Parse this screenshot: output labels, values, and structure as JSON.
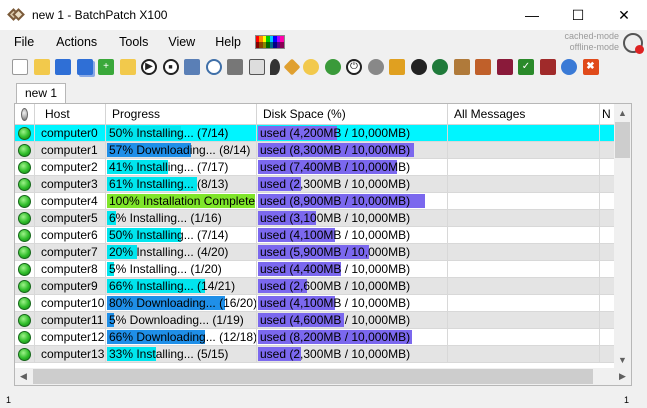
{
  "window": {
    "title": "new 1 - BatchPatch X100",
    "minimize_glyph": "—",
    "maximize_glyph": "☐",
    "close_glyph": "✕"
  },
  "menu": {
    "items": [
      "File",
      "Actions",
      "Tools",
      "View",
      "Help"
    ]
  },
  "modes": {
    "cached": "cached-mode",
    "offline": "offline-mode"
  },
  "toolbar": {
    "icons": [
      "new-file-icon",
      "open-folder-icon",
      "save-icon",
      "save-all-icon",
      "add-host-icon",
      "group-icon",
      "play-icon",
      "stop-icon",
      "network-icon",
      "schedule-icon",
      "deploy-icon",
      "script-icon",
      "location-icon",
      "tag-icon",
      "search-icon",
      "refresh-icon",
      "power-icon",
      "settings-icon",
      "unlock-icon",
      "wheel-icon",
      "wheel-green-icon",
      "package-icon",
      "commands-icon",
      "book-icon",
      "check-icon",
      "monitor-icon",
      "globe-icon",
      "remove-icon"
    ]
  },
  "tabs": [
    {
      "label": "new 1"
    }
  ],
  "grid": {
    "headers": {
      "host": "Host",
      "progress": "Progress",
      "disk": "Disk Space (%)",
      "messages": "All Messages",
      "next": "N"
    },
    "rows": [
      {
        "host": "computer0",
        "progress": "50% Installing... (7/14)",
        "progress_pct": 50,
        "progress_kind": "install",
        "disk": "used (4,200MB / 10,000MB)",
        "disk_pct": 42,
        "selected": true
      },
      {
        "host": "computer1",
        "progress": "57% Downloading... (8/14)",
        "progress_pct": 57,
        "progress_kind": "download",
        "disk": "used (8,300MB / 10,000MB)",
        "disk_pct": 83
      },
      {
        "host": "computer2",
        "progress": "41% Installing... (7/17)",
        "progress_pct": 41,
        "progress_kind": "install",
        "disk": "used (7,400MB / 10,000MB)",
        "disk_pct": 74
      },
      {
        "host": "computer3",
        "progress": "61% Installing... (8/13)",
        "progress_pct": 61,
        "progress_kind": "install",
        "disk": "used (2,300MB / 10,000MB)",
        "disk_pct": 23
      },
      {
        "host": "computer4",
        "progress": "100% Installation Complete",
        "progress_pct": 100,
        "progress_kind": "complete",
        "disk": "used (8,900MB / 10,000MB)",
        "disk_pct": 89
      },
      {
        "host": "computer5",
        "progress": "6% Installing... (1/16)",
        "progress_pct": 6,
        "progress_kind": "install",
        "disk": "used (3,100MB / 10,000MB)",
        "disk_pct": 31
      },
      {
        "host": "computer6",
        "progress": "50% Installing... (7/14)",
        "progress_pct": 50,
        "progress_kind": "install",
        "disk": "used (4,100MB / 10,000MB)",
        "disk_pct": 41
      },
      {
        "host": "computer7",
        "progress": "20% Installing... (4/20)",
        "progress_pct": 20,
        "progress_kind": "install",
        "disk": "used (5,900MB / 10,000MB)",
        "disk_pct": 59
      },
      {
        "host": "computer8",
        "progress": "5% Installing... (1/20)",
        "progress_pct": 5,
        "progress_kind": "install",
        "disk": "used (4,400MB / 10,000MB)",
        "disk_pct": 44
      },
      {
        "host": "computer9",
        "progress": "66% Installing... (14/21)",
        "progress_pct": 66,
        "progress_kind": "install",
        "disk": "used (2,600MB / 10,000MB)",
        "disk_pct": 26
      },
      {
        "host": "computer10",
        "progress": "80% Downloading... (16/20)",
        "progress_pct": 80,
        "progress_kind": "download",
        "disk": "used (4,100MB / 10,000MB)",
        "disk_pct": 41
      },
      {
        "host": "computer11",
        "progress": "5% Downloading... (1/19)",
        "progress_pct": 5,
        "progress_kind": "download",
        "disk": "used (4,600MB / 10,000MB)",
        "disk_pct": 46
      },
      {
        "host": "computer12",
        "progress": "66% Downloading... (12/18)",
        "progress_pct": 66,
        "progress_kind": "download",
        "disk": "used (8,200MB / 10,000MB)",
        "disk_pct": 82
      },
      {
        "host": "computer13",
        "progress": "33% Installing... (5/15)",
        "progress_pct": 33,
        "progress_kind": "install",
        "disk": "used (2,300MB / 10,000MB)",
        "disk_pct": 23
      }
    ]
  },
  "colors": {
    "install": "#00e5ee",
    "download": "#1f8fe8",
    "complete": "#7fe52a",
    "disk": "#7b68ee",
    "selected_row": "#00f5ff"
  },
  "status": {
    "left": "1",
    "right": "1"
  }
}
